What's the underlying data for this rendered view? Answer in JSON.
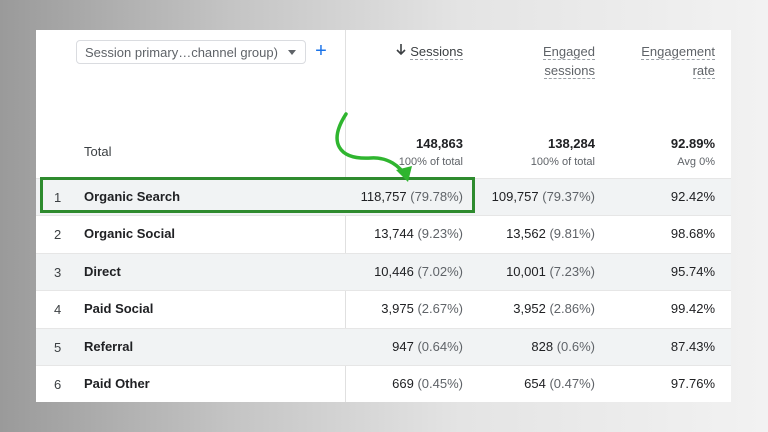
{
  "toolbar": {
    "dimension_label": "Session primary…channel group)",
    "add_label": "+"
  },
  "columns": {
    "sessions": "Sessions",
    "engaged_line1": "Engaged",
    "engaged_line2": "sessions",
    "rate_line1": "Engagement",
    "rate_line2": "rate"
  },
  "total": {
    "label": "Total",
    "sessions": "148,863",
    "sessions_sub": "100% of total",
    "engaged": "138,284",
    "engaged_sub": "100% of total",
    "rate": "92.89%",
    "rate_sub": "Avg 0%"
  },
  "rows": [
    {
      "idx": "1",
      "name": "Organic Search",
      "sessions": "118,757",
      "sessions_pct": "(79.78%)",
      "engaged": "109,757",
      "engaged_pct": "(79.37%)",
      "rate": "92.42%"
    },
    {
      "idx": "2",
      "name": "Organic Social",
      "sessions": "13,744",
      "sessions_pct": "(9.23%)",
      "engaged": "13,562",
      "engaged_pct": "(9.81%)",
      "rate": "98.68%"
    },
    {
      "idx": "3",
      "name": "Direct",
      "sessions": "10,446",
      "sessions_pct": "(7.02%)",
      "engaged": "10,001",
      "engaged_pct": "(7.23%)",
      "rate": "95.74%"
    },
    {
      "idx": "4",
      "name": "Paid Social",
      "sessions": "3,975",
      "sessions_pct": "(2.67%)",
      "engaged": "3,952",
      "engaged_pct": "(2.86%)",
      "rate": "99.42%"
    },
    {
      "idx": "5",
      "name": "Referral",
      "sessions": "947",
      "sessions_pct": "(0.64%)",
      "engaged": "828",
      "engaged_pct": "(0.6%)",
      "rate": "87.43%"
    },
    {
      "idx": "6",
      "name": "Paid Other",
      "sessions": "669",
      "sessions_pct": "(0.45%)",
      "engaged": "654",
      "engaged_pct": "(0.47%)",
      "rate": "97.76%"
    }
  ],
  "annotation": {
    "color": "#2e8b2e",
    "highlighted_row": "Organic Search"
  }
}
